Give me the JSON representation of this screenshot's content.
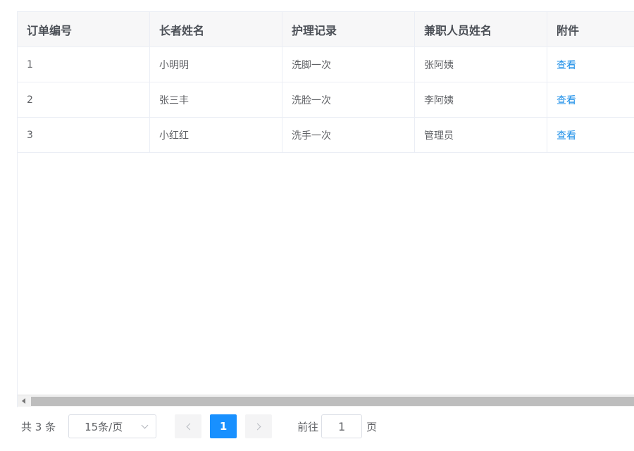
{
  "table": {
    "columns": [
      "订单编号",
      "长者姓名",
      "护理记录",
      "兼职人员姓名",
      "附件"
    ],
    "rows": [
      {
        "order_no": "1",
        "elder_name": "小明明",
        "record": "洗脚一次",
        "staff": "张阿姨",
        "attachment": "查看"
      },
      {
        "order_no": "2",
        "elder_name": "张三丰",
        "record": "洗脸一次",
        "staff": "李阿姨",
        "attachment": "查看"
      },
      {
        "order_no": "3",
        "elder_name": "小红红",
        "record": "洗手一次",
        "staff": "管理员",
        "attachment": "查看"
      }
    ]
  },
  "pagination": {
    "total_text": "共 3 条",
    "page_size": "15条/页",
    "current_page": "1",
    "goto_label": "前往",
    "goto_value": "1",
    "page_unit": "页"
  },
  "colors": {
    "accent": "#1890ff",
    "link": "#1b8ee8",
    "header_bg": "#f7f7f8",
    "border": "#ebeef5"
  }
}
